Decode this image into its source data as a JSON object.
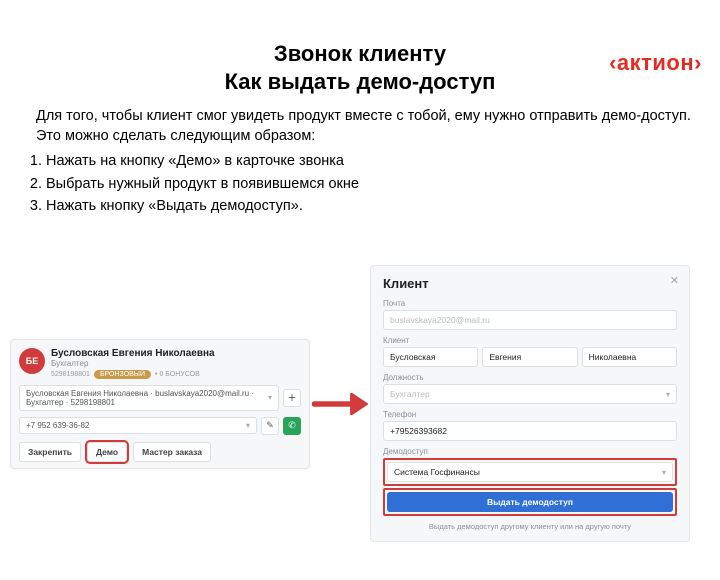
{
  "brand": "‹актион›",
  "heading_1": "Звонок клиенту",
  "heading_2": "Как выдать демо-доступ",
  "intro": "Для того, чтобы клиент смог увидеть продукт вместе с тобой, ему нужно отправить демо-доступ. Это можно сделать следующим образом:",
  "steps": {
    "s1": "Нажать на кнопку «Демо» в карточке звонка",
    "s2": "Выбрать нужный продукт в появившемся окне",
    "s3": "Нажать кнопку «Выдать демодоступ»."
  },
  "card": {
    "avatar": "БЕ",
    "name": "Бусловская Евгения Николаевна",
    "role": "Бухгалтер",
    "id": "5298198801",
    "chip": "БРОНЗОВЫЙ",
    "bonus": "• 0 БОНУСОВ",
    "contact_line": "Бусловская Евгения Николаевна · buslavskaya2020@mail.ru · Бухгалтер · 5298198801",
    "phone": "+7 952 639-36-82",
    "btn_pin": "Закрепить",
    "btn_demo": "Демо",
    "btn_order": "Мастер заказа"
  },
  "panel": {
    "title": "Клиент",
    "lbl_mail": "Почта",
    "mail_value": "buslavskaya2020@mail.ru",
    "lbl_client": "Клиент",
    "ln": "Бусловская",
    "fn": "Евгения",
    "mn": "Николаевна",
    "lbl_position": "Должность",
    "position": "Бухгалтер",
    "lbl_phone": "Телефон",
    "phone": "+79526393682",
    "lbl_demo": "Демодоступ",
    "demo_product": "Система Госфинансы",
    "grant_btn": "Выдать демодоступ",
    "footer": "Выдать демодоступ другому клиенту или на другую почту"
  }
}
